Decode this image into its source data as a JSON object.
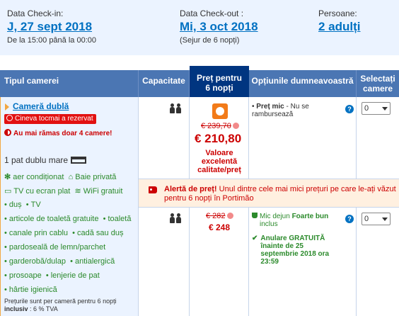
{
  "summary": {
    "checkin_label": "Data Check-in:",
    "checkin_value": "J, 27 sept 2018",
    "checkin_sub": "De la 15:00 până la 00:00",
    "checkout_label": "Data Check-out :",
    "checkout_value": "Mi, 3 oct 2018",
    "checkout_sub": "(Sejur de 6 nopți)",
    "guests_label": "Persoane:",
    "guests_value": "2 adulți"
  },
  "table": {
    "headers": {
      "room_type": "Tipul camerei",
      "capacity": "Capacitate",
      "price_line1": "Preț pentru",
      "price_line2": "6 nopți",
      "options": "Opțiunile dumneavoastră",
      "select_line1": "Selectați",
      "select_line2": "camere"
    }
  },
  "room": {
    "name": "Cameră dublă",
    "booked_badge": "Cineva tocmai a rezervat",
    "rooms_left": "Au mai rămas doar 4 camere!",
    "bed": "1 pat dublu mare",
    "facilities": [
      [
        "aer condiționat",
        "Baie privată"
      ],
      [
        "TV cu ecran plat",
        "WiFi gratuit"
      ],
      [
        "duș",
        "TV"
      ],
      [
        "articole de toaletă gratuite",
        "toaletă"
      ],
      [
        "canale prin cablu",
        "cadă sau duș"
      ],
      [
        "pardoseală de lemn/parchet"
      ],
      [
        "garderobă/dulap",
        "antialergică"
      ],
      [
        "prosoape",
        "lenjerie de pat"
      ],
      [
        "hârtie igienică"
      ]
    ],
    "note_line1": "Prețurile sunt per cameră pentru 6 nopți",
    "note_line2_bold": "inclusiv",
    "note_line2_rest": " : 6 % TVA"
  },
  "offers": [
    {
      "old_price": "€ 239,70",
      "price": "€ 210,80",
      "value_note": "Valoare excelentă calitate/preț",
      "option_title": "Preț mic",
      "option_desc": " - Nu se rambursează",
      "select_value": "0"
    },
    {
      "old_price": "€ 282",
      "price": "€ 248",
      "breakfast_pre": "Mic dejun ",
      "breakfast_bold": "Foarte bun",
      "breakfast_post": "inclus",
      "cancel_text": "Anulare GRATUITĂ înainte de 25 septembrie 2018 ora 23:59",
      "select_value": "0"
    }
  ],
  "alert": {
    "title": "Alertă de preț!",
    "text": " Unul dintre cele mai mici prețuri pe care le-ați văzut pentru 6 nopți în Portimão"
  },
  "colors": {
    "link": "#0071c2",
    "header_bg": "#4b76b3",
    "price_header_bg": "#003580",
    "price_red": "#cc0000",
    "facility_green": "#2b8a2b"
  }
}
